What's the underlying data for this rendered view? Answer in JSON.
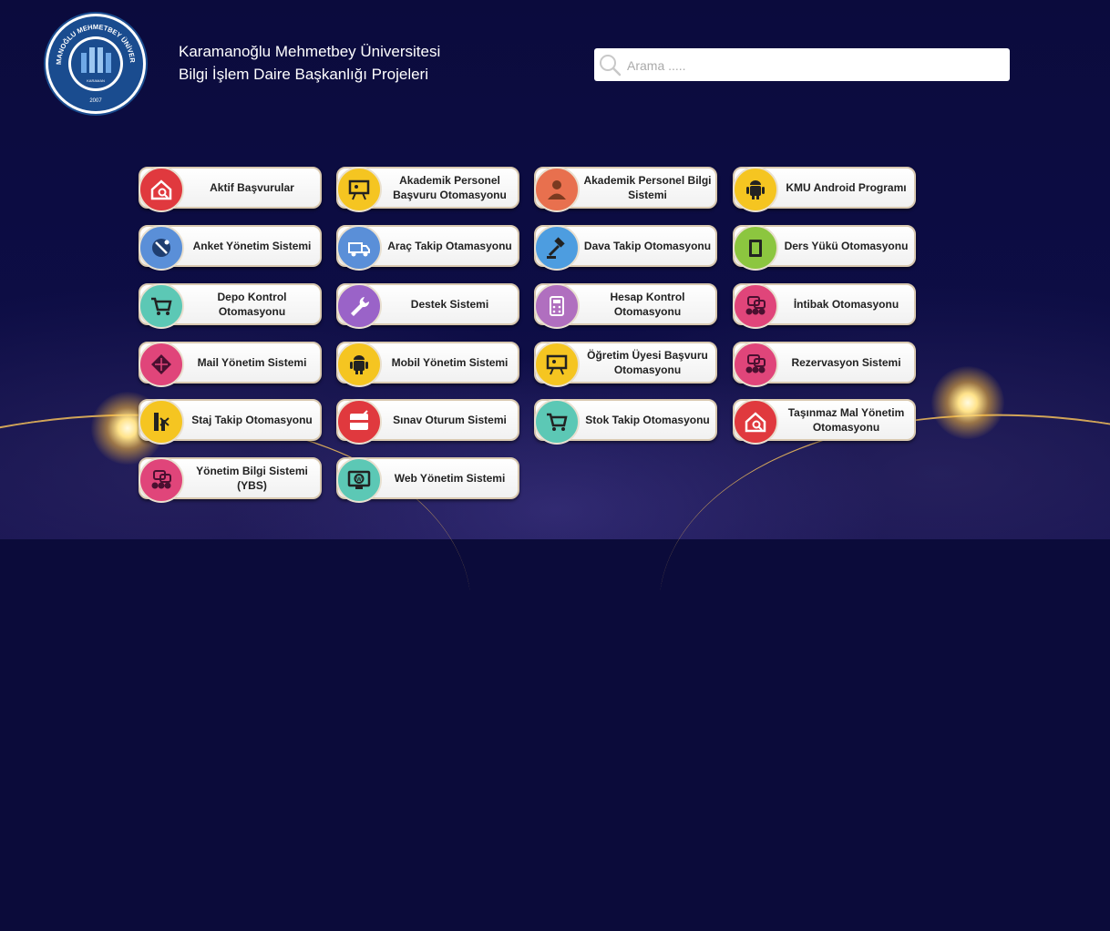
{
  "header": {
    "title_line1": "Karamanoğlu Mehmetbey Üniversitesi",
    "title_line2": "Bilgi İşlem Daire Başkanlığı Projeleri",
    "logo": {
      "arc_text": "KARAMANOĞLU MEHMETBEY ÜNİVERSİTESİ",
      "city": "KARAMAN",
      "year": "2007"
    }
  },
  "search": {
    "placeholder": "Arama ....."
  },
  "projects": [
    {
      "label": "Aktif Başvurular",
      "icon": "house-search-icon",
      "color": "#e0393e"
    },
    {
      "label": "Akademik Personel Başvuru Otomasyonu",
      "icon": "presentation-board-icon",
      "color": "#f5c521"
    },
    {
      "label": "Akademik Personel Bilgi Sistemi",
      "icon": "user-silhouette-icon",
      "color": "#e8704e"
    },
    {
      "label": "KMU Android Programı",
      "icon": "android-icon",
      "color": "#f5c521"
    },
    {
      "label": "Anket Yönetim Sistemi",
      "icon": "satellite-dish-icon",
      "color": "#5a8fd8"
    },
    {
      "label": "Araç Takip Otamasyonu",
      "icon": "truck-icon",
      "color": "#5a8fd8"
    },
    {
      "label": "Dava Takip Otomasyonu",
      "icon": "gavel-icon",
      "color": "#4d9de0"
    },
    {
      "label": "Ders Yükü Otomasyonu",
      "icon": "book-icon",
      "color": "#8cc63f"
    },
    {
      "label": "Depo Kontrol Otomasyonu",
      "icon": "shopping-cart-icon",
      "color": "#5cc8b5"
    },
    {
      "label": "Destek Sistemi",
      "icon": "wrench-icon",
      "color": "#9a63c8"
    },
    {
      "label": "Hesap Kontrol Otomasyonu",
      "icon": "calculator-icon",
      "color": "#b06fbf"
    },
    {
      "label": "İntibak Otomasyonu",
      "icon": "people-group-icon",
      "color": "#e0457a"
    },
    {
      "label": "Mail Yönetim Sistemi",
      "icon": "envelope-icon",
      "color": "#e0457a"
    },
    {
      "label": "Mobil Yönetim Sistemi",
      "icon": "android-icon",
      "color": "#f5c521"
    },
    {
      "label": "Öğretim Üyesi Başvuru Otomasyonu",
      "icon": "presentation-board-icon",
      "color": "#f5c521"
    },
    {
      "label": "Rezervasyon Sistemi",
      "icon": "people-group-icon",
      "color": "#e0457a"
    },
    {
      "label": "Staj Takip Otomasyonu",
      "icon": "org-chart-icon",
      "color": "#f5c521"
    },
    {
      "label": "Sınav Oturum Sistemi",
      "icon": "exam-form-icon",
      "color": "#e0393e"
    },
    {
      "label": "Stok Takip Otomasyonu",
      "icon": "shopping-cart-icon",
      "color": "#5cc8b5"
    },
    {
      "label": "Taşınmaz Mal Yönetim Otomasyonu",
      "icon": "house-search-icon",
      "color": "#e0393e"
    },
    {
      "label": "Yönetim Bilgi Sistemi (YBS)",
      "icon": "people-group-icon",
      "color": "#e0457a"
    },
    {
      "label": "Web Yönetim Sistemi",
      "icon": "web-monitor-icon",
      "color": "#5cc8b5"
    }
  ]
}
